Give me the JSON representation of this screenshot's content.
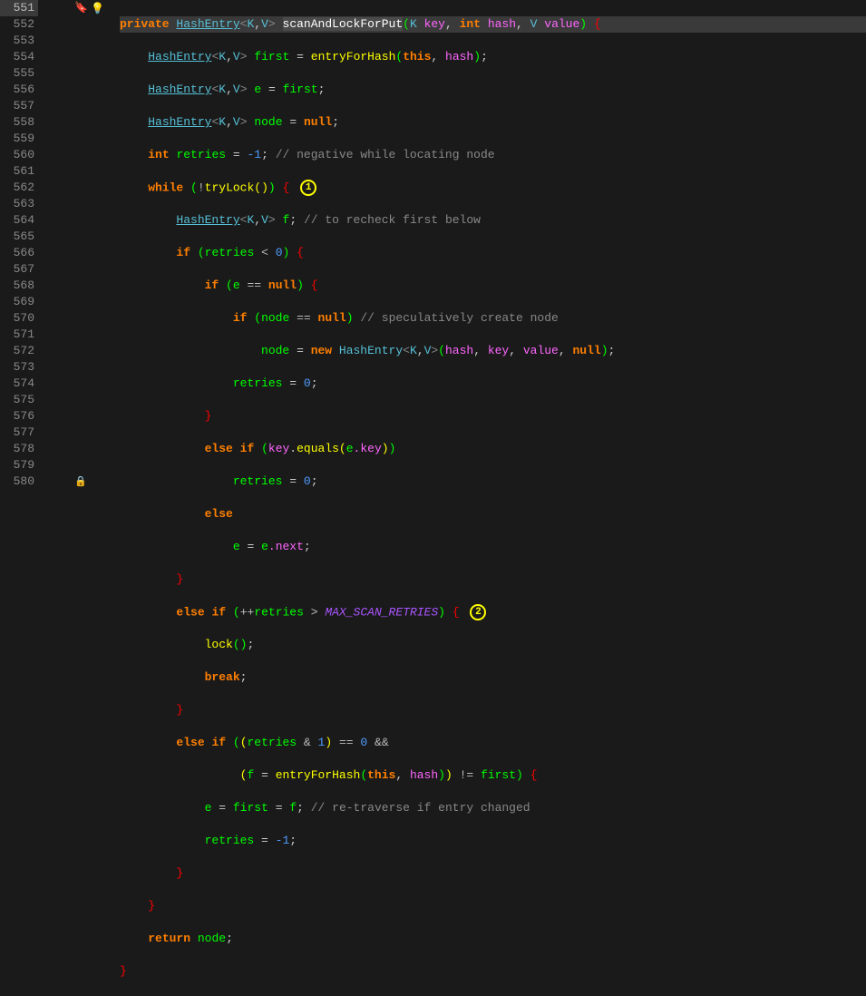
{
  "lines": [
    {
      "n": 551,
      "hl": true
    },
    {
      "n": 552
    },
    {
      "n": 553
    },
    {
      "n": 554
    },
    {
      "n": 555
    },
    {
      "n": 556
    },
    {
      "n": 557
    },
    {
      "n": 558
    },
    {
      "n": 559
    },
    {
      "n": 560
    },
    {
      "n": 561
    },
    {
      "n": 562
    },
    {
      "n": 563
    },
    {
      "n": 564
    },
    {
      "n": 565
    },
    {
      "n": 566
    },
    {
      "n": 567
    },
    {
      "n": 568
    },
    {
      "n": 569
    },
    {
      "n": 570
    },
    {
      "n": 571
    },
    {
      "n": 572
    },
    {
      "n": 573
    },
    {
      "n": 574
    },
    {
      "n": 575
    },
    {
      "n": 576
    },
    {
      "n": 577
    },
    {
      "n": 578
    },
    {
      "n": 579
    },
    {
      "n": 580
    }
  ],
  "tok": {
    "private": "private",
    "HashEntry": "HashEntry",
    "K": "K",
    "V": "V",
    "scanAndLockForPut": "scanAndLockForPut",
    "key": "key",
    "hash": "hash",
    "value": "value",
    "int_kw": "int",
    "first": "first",
    "entryForHash": "entryForHash",
    "this": "this",
    "e": "e",
    "node": "node",
    "null": "null",
    "retries": "retries",
    "neg1": "-1",
    "cmt1": "// negative while locating node",
    "while": "while",
    "tryLock": "tryLock",
    "annot1": "1",
    "f": "f",
    "cmt2": "// to recheck first below",
    "if": "if",
    "zero": "0",
    "cmt3": "// speculatively create node",
    "new": "new",
    "else": "else",
    "equals": "equals",
    "dotkey": ".key",
    "next": ".next",
    "MAX_SCAN_RETRIES": "MAX_SCAN_RETRIES",
    "annot2": "2",
    "lock": "lock",
    "break": "break",
    "amp": "&",
    "one": "1",
    "ampamp": "&&",
    "eqeq": "==",
    "cmt4": "// re-traverse if entry changed",
    "return": "return"
  }
}
